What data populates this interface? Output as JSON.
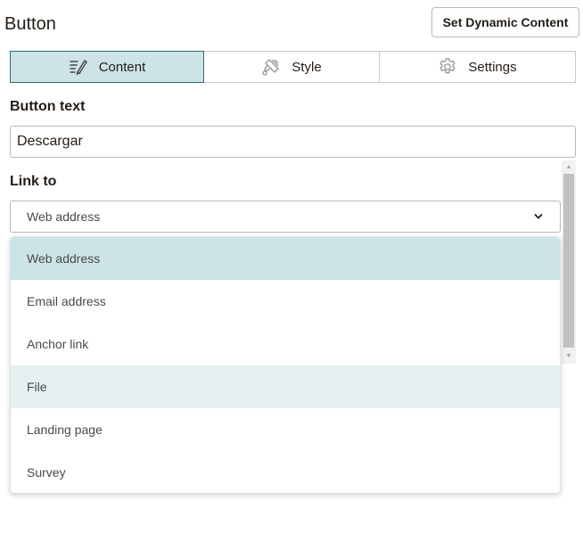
{
  "header": {
    "title": "Button",
    "dynamic_button_label": "Set Dynamic Content"
  },
  "tabs": [
    {
      "label": "Content",
      "icon": "pencil-lines-icon",
      "active": true
    },
    {
      "label": "Style",
      "icon": "paint-brush-icon",
      "active": false
    },
    {
      "label": "Settings",
      "icon": "gear-icon",
      "active": false
    }
  ],
  "button_text": {
    "label": "Button text",
    "value": "Descargar"
  },
  "link_to": {
    "label": "Link to",
    "selected": "Web address",
    "options": [
      {
        "label": "Web address",
        "state": "selected"
      },
      {
        "label": "Email address",
        "state": "normal"
      },
      {
        "label": "Anchor link",
        "state": "normal"
      },
      {
        "label": "File",
        "state": "hovered"
      },
      {
        "label": "Landing page",
        "state": "normal"
      },
      {
        "label": "Survey",
        "state": "normal"
      }
    ]
  },
  "colors": {
    "active_tab_bg": "#cde4e6",
    "active_tab_border": "#2f6a70",
    "hover_option_bg": "#e4f0f1",
    "text": "#241c15"
  }
}
